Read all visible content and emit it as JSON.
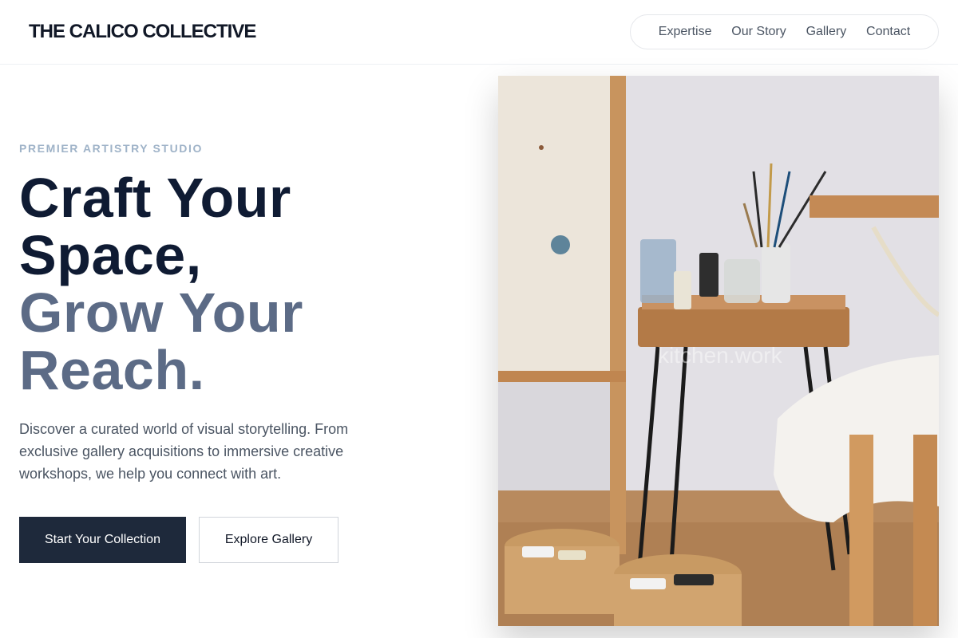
{
  "brand": {
    "name": "THE CALICO COLLECTIVE"
  },
  "nav": {
    "items": [
      {
        "label": "Expertise"
      },
      {
        "label": "Our Story"
      },
      {
        "label": "Gallery"
      },
      {
        "label": "Contact"
      }
    ]
  },
  "hero": {
    "eyebrow": "PREMIER ARTISTRY STUDIO",
    "headline": {
      "line1": "Craft Your",
      "line2": "Space,",
      "line3": "Grow Your",
      "line4": "Reach."
    },
    "description": "Discover a curated world of visual storytelling. From exclusive gallery acquisitions to immersive creative workshops, we help you connect with art.",
    "primary_button": "Start Your Collection",
    "secondary_button": "Explore Gallery"
  },
  "image": {
    "watermark": "kitchen.work"
  },
  "colors": {
    "headline_dark": "#0f1b33",
    "headline_muted": "#5c6b86",
    "eyebrow": "#9fb3c8",
    "primary_button_bg": "#1e293b"
  }
}
